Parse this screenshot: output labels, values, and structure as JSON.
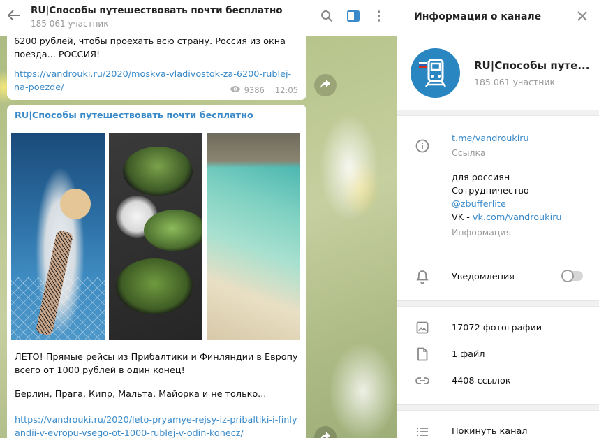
{
  "chat": {
    "title": "RU|Способы путешествовать почти бесплатно",
    "subtitle": "185 061 участник",
    "message1": {
      "text": "6200 рублей, чтобы проехать всю страну. Россия из окна поезда... РОССИЯ!",
      "link": "https://vandrouki.ru/2020/moskva-vladivostok-za-6200-rublej-na-poezde/",
      "views": "9386",
      "time": "12:05"
    },
    "message2": {
      "channel": "RU|Способы путешествовать почти бесплатно",
      "text": "ЛЕТО! Прямые рейсы из Прибалтики и Финляндии в Европу всего от 1000 рублей в один конец!",
      "text2": "Берлин, Прага, Кипр, Мальта, Майорка и не только...",
      "link": "https://vandrouki.ru/2020/leto-pryamye-rejsy-iz-pribaltiki-i-finlyandii-v-evropu-vsego-ot-1000-rublej-v-odin-konecz/"
    }
  },
  "panel": {
    "title": "Информация о канале",
    "channel_name": "RU|Способы путе...",
    "members": "185 061 участник",
    "link": "t.me/vandroukiru",
    "link_label": "Ссылка",
    "desc_line1": "для россиян",
    "desc_line2": "Сотрудничество -",
    "desc_line3": "@zbufferlite",
    "desc_vk_prefix": "VK - ",
    "desc_vk_link": "vk.com/vandroukiru",
    "desc_label": "Информация",
    "notifications": "Уведомления",
    "notifications_on": false,
    "photos": "17072 фотографии",
    "files": "1 файл",
    "links": "4408 ссылок",
    "leave": "Покинуть канал"
  },
  "colors": {
    "accent": "#3a8ac9",
    "avatar": "#2a86c0"
  }
}
